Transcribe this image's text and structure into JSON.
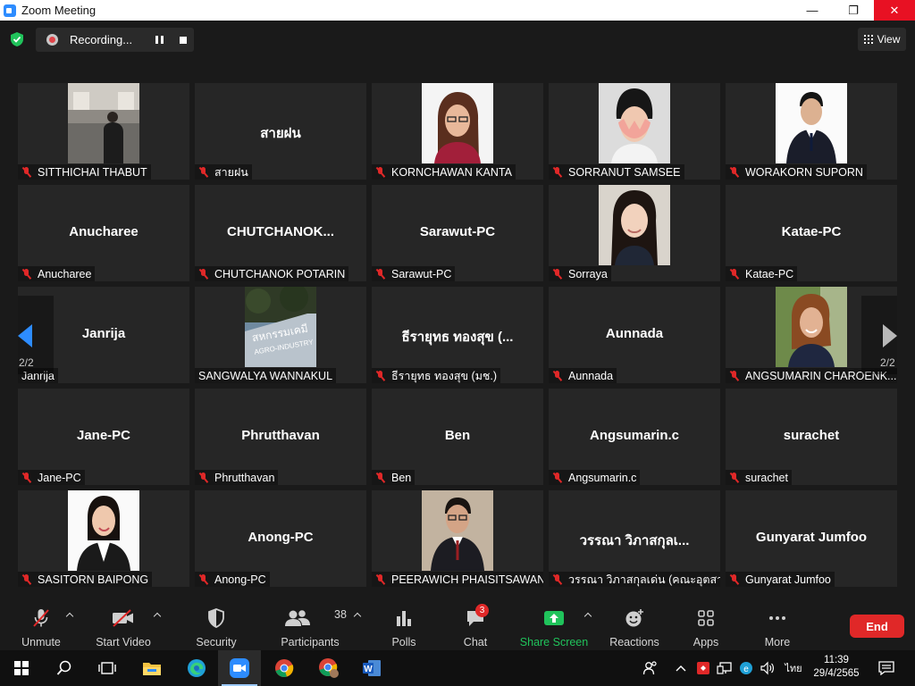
{
  "window": {
    "title": "Zoom Meeting",
    "minimize": "—",
    "maximize": "❐",
    "close": "✕"
  },
  "meeting": {
    "recording_label": "Recording...",
    "view_label": "View",
    "page_indicator_left": "2/2",
    "page_indicator_right": "2/2"
  },
  "participants": [
    {
      "name": "SITTHICHAI THABUT",
      "display": "",
      "has_photo": true,
      "photo": "room",
      "muted": true
    },
    {
      "name": "สายฝน",
      "display": "สายฝน",
      "has_photo": false,
      "muted": true
    },
    {
      "name": "KORNCHAWAN KANTA",
      "display": "",
      "has_photo": true,
      "photo": "woman-glasses",
      "muted": true
    },
    {
      "name": "SORRANUT SAMSEE",
      "display": "",
      "has_photo": true,
      "photo": "face-cover",
      "muted": true
    },
    {
      "name": "WORAKORN SUPORN",
      "display": "",
      "has_photo": true,
      "photo": "man-suit",
      "muted": true
    },
    {
      "name": "Anucharee",
      "display": "Anucharee",
      "has_photo": false,
      "muted": true
    },
    {
      "name": "CHUTCHANOK POTARIN",
      "display": "CHUTCHANOK...",
      "has_photo": false,
      "muted": true
    },
    {
      "name": "Sarawut-PC",
      "display": "Sarawut-PC",
      "has_photo": false,
      "muted": true
    },
    {
      "name": "Sorraya",
      "display": "",
      "has_photo": true,
      "photo": "woman-long-hair",
      "muted": true
    },
    {
      "name": "Katae-PC",
      "display": "Katae-PC",
      "has_photo": false,
      "muted": true
    },
    {
      "name": "Janrija",
      "display": "Janrija",
      "has_photo": false,
      "muted": false
    },
    {
      "name": "SANGWALYA WANNAKUL",
      "display": "",
      "has_photo": true,
      "photo": "building",
      "muted": false
    },
    {
      "name": "ธีรายุทธ ทองสุข (มช.)",
      "display": "ธีรายุทธ ทองสุข (...",
      "has_photo": false,
      "muted": true
    },
    {
      "name": "Aunnada",
      "display": "Aunnada",
      "has_photo": false,
      "muted": true
    },
    {
      "name": "ANGSUMARIN CHAROENK...",
      "display": "",
      "has_photo": true,
      "photo": "woman-outdoor",
      "muted": true
    },
    {
      "name": "Jane-PC",
      "display": "Jane-PC",
      "has_photo": false,
      "muted": true
    },
    {
      "name": "Phrutthavan",
      "display": "Phrutthavan",
      "has_photo": false,
      "muted": true
    },
    {
      "name": "Ben",
      "display": "Ben",
      "has_photo": false,
      "muted": true
    },
    {
      "name": "Angsumarin.c",
      "display": "Angsumarin.c",
      "has_photo": false,
      "muted": true
    },
    {
      "name": "surachet",
      "display": "surachet",
      "has_photo": false,
      "muted": true
    },
    {
      "name": "SASITORN BAIPONG",
      "display": "",
      "has_photo": true,
      "photo": "woman-uniform",
      "muted": true
    },
    {
      "name": "Anong-PC",
      "display": "Anong-PC",
      "has_photo": false,
      "muted": true
    },
    {
      "name": "PEERAWICH PHAISITSAWAN",
      "display": "",
      "has_photo": true,
      "photo": "man-glasses",
      "muted": true
    },
    {
      "name": "วรรณา วิภาสกุลเด่น (คณะอุตสา...",
      "display": "วรรณา วิภาสกุลเ...",
      "has_photo": false,
      "muted": true
    },
    {
      "name": "Gunyarat Jumfoo",
      "display": "Gunyarat Jumfoo",
      "has_photo": false,
      "muted": true
    }
  ],
  "toolbar": {
    "unmute": "Unmute",
    "start_video": "Start Video",
    "security": "Security",
    "participants": "Participants",
    "participants_count": "38",
    "polls": "Polls",
    "chat": "Chat",
    "chat_badge": "3",
    "share_screen": "Share Screen",
    "reactions": "Reactions",
    "apps": "Apps",
    "more": "More",
    "end": "End"
  },
  "taskbar": {
    "language": "ไทย",
    "time": "11:39",
    "date": "29/4/2565"
  },
  "colors": {
    "accent_blue": "#2d8cff",
    "end_red": "#e02828",
    "share_green": "#20c35b",
    "tile_bg": "#262626"
  }
}
